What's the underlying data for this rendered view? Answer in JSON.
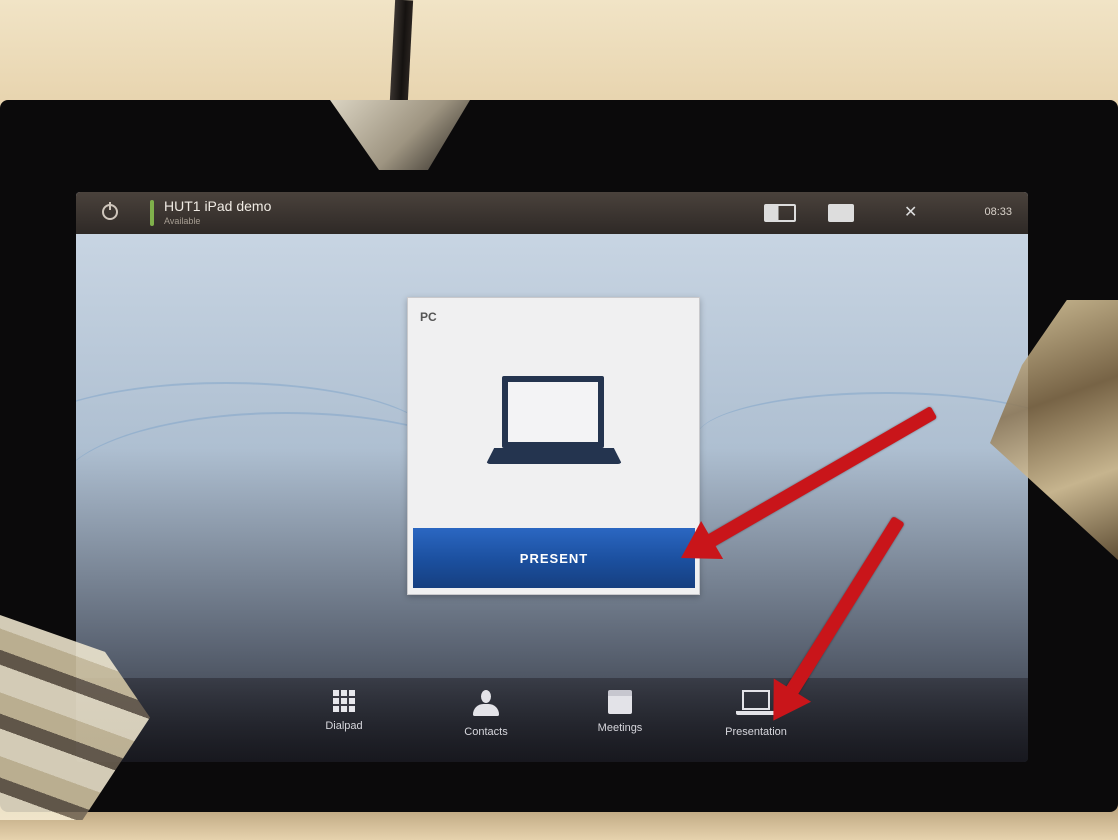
{
  "status_bar": {
    "system_name": "HUT1 iPad demo",
    "system_subtitle": "Available",
    "clock": "08:33",
    "icons": [
      "power-icon",
      "layout-icon",
      "camera-icon",
      "settings-icon"
    ]
  },
  "source_panel": {
    "title": "PC",
    "source_icon": "laptop-icon",
    "present_label": "PRESENT"
  },
  "nav": {
    "items": [
      {
        "label": "Dialpad",
        "icon": "dialpad-icon"
      },
      {
        "label": "Contacts",
        "icon": "contacts-icon"
      },
      {
        "label": "Meetings",
        "icon": "meetings-icon"
      },
      {
        "label": "Presentation",
        "icon": "presentation-icon"
      }
    ]
  },
  "colors": {
    "present_button": "#1b4f9e",
    "annotation_arrow": "#c9151a",
    "presence_indicator": "#7fb04b"
  }
}
